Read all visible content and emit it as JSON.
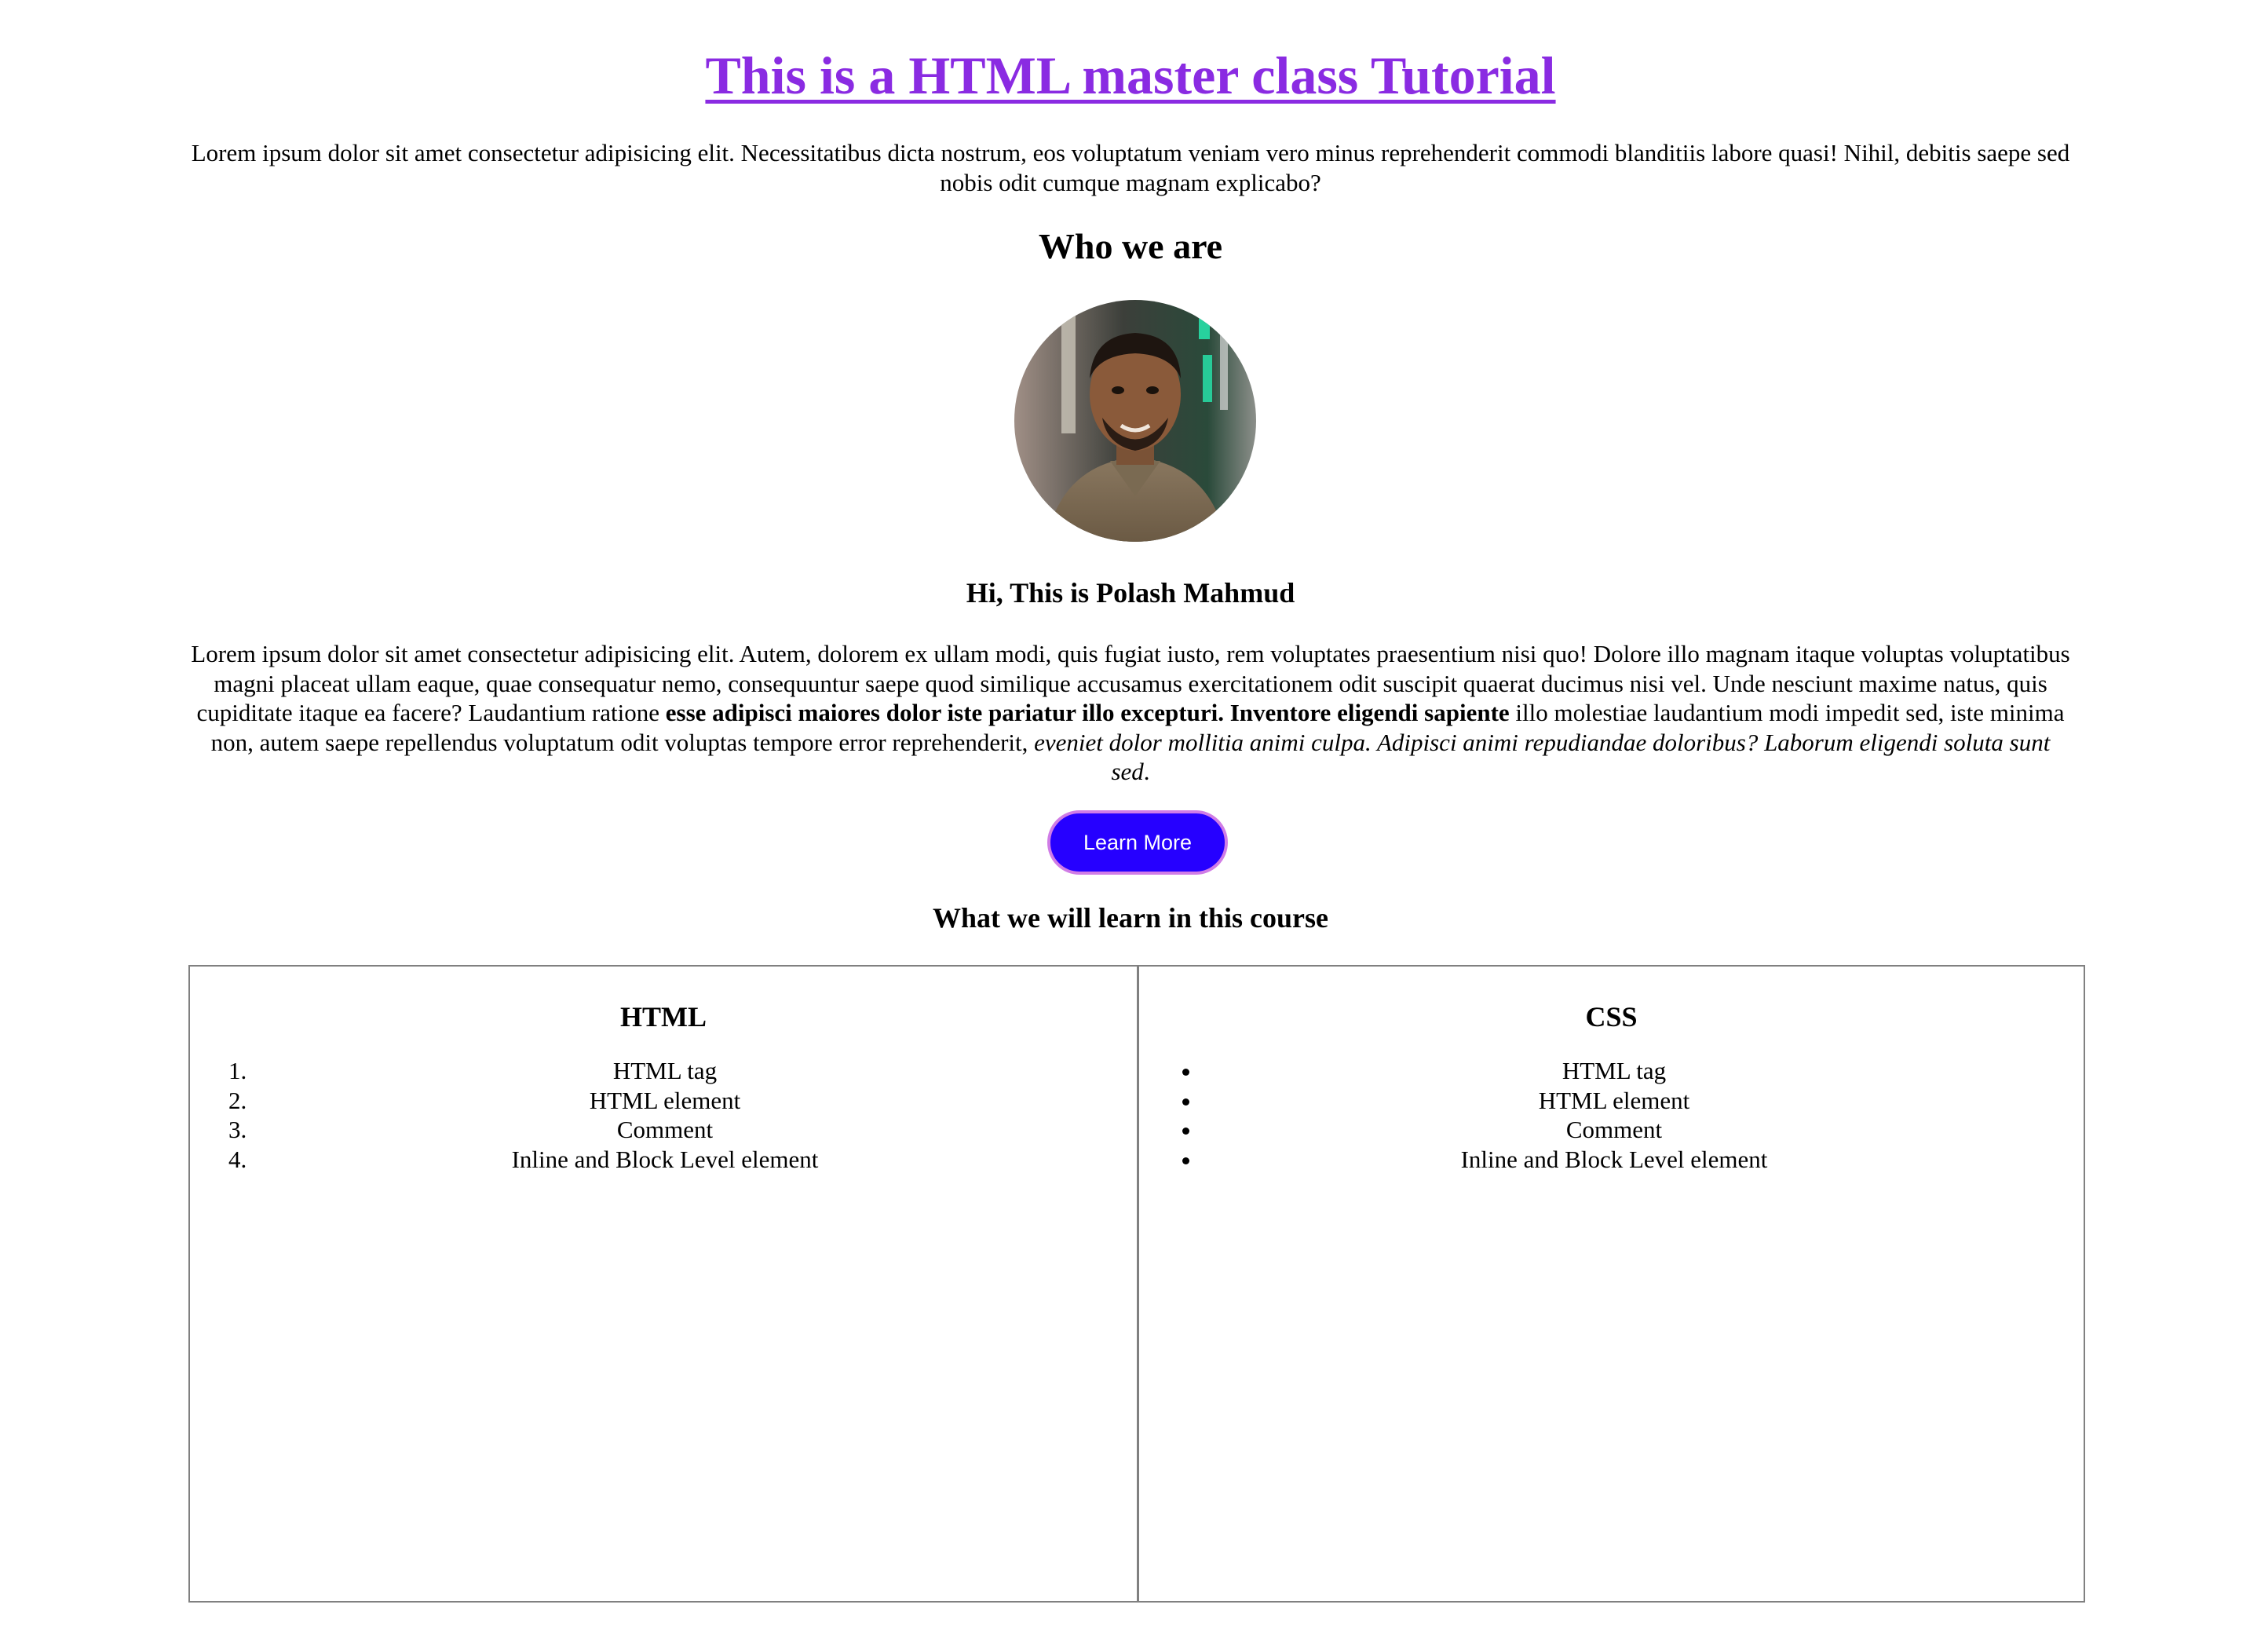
{
  "header": {
    "title": "This is a HTML master class Tutorial",
    "intro": "Lorem ipsum dolor sit amet consectetur adipisicing elit. Necessitatibus dicta nostrum, eos voluptatum veniam vero minus reprehenderit commodi blanditiis labore quasi! Nihil, debitis saepe sed nobis odit cumque magnam explicabo?"
  },
  "about": {
    "title": "Who we are",
    "avatar_icon": "profile-photo",
    "greeting": "Hi, This is Polash Mahmud",
    "bio_plain_1": "Lorem ipsum dolor sit amet consectetur adipisicing elit. Autem, dolorem ex ullam modi, quis fugiat iusto, rem voluptates praesentium nisi quo! Dolore illo magnam itaque voluptas voluptatibus magni placeat ullam eaque, quae consequatur nemo, consequuntur saepe quod similique accusamus exercitationem odit suscipit quaerat ducimus nisi vel. Unde nesciunt maxime natus, quis cupiditate itaque ea facere? Laudantium ratione ",
    "bio_bold": "esse adipisci maiores dolor iste pariatur illo excepturi. Inventore eligendi sapiente",
    "bio_plain_2": " illo molestiae laudantium modi impedit sed, iste minima non, autem saepe repellendus voluptatum odit voluptas tempore error reprehenderit, ",
    "bio_italic": "eveniet dolor mollitia animi culpa. Adipisci animi repudiandae doloribus? Laborum eligendi soluta sunt sed",
    "bio_plain_3": ".",
    "button_label": "Learn More",
    "button_color": "#2600ff"
  },
  "course": {
    "title": "What we will learn in this course",
    "columns": [
      {
        "title": "HTML",
        "list_type": "ordered",
        "items": [
          "HTML tag",
          "HTML element",
          "Comment",
          "Inline and Block Level element"
        ]
      },
      {
        "title": "CSS",
        "list_type": "unordered",
        "items": [
          "HTML tag",
          "HTML element",
          "Comment",
          "Inline and Block Level element"
        ]
      }
    ]
  },
  "colors": {
    "link": "#8a2be2",
    "button_border": "#d07ce6",
    "table_border": "#808080"
  }
}
